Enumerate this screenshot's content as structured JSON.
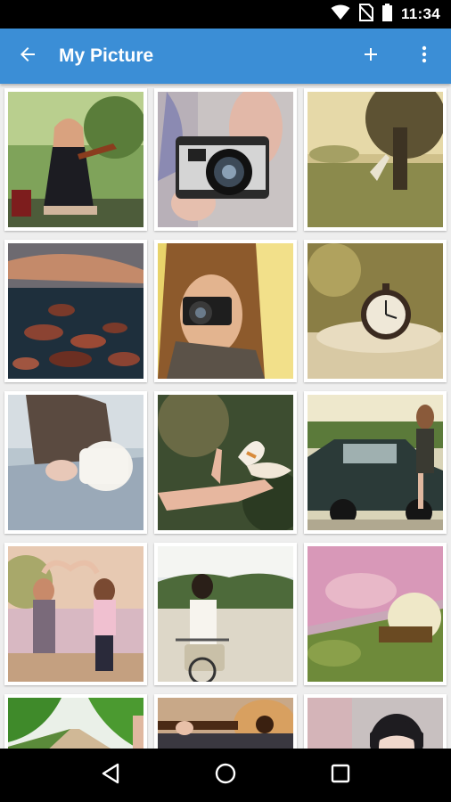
{
  "status_bar": {
    "time": "11:34",
    "icons": [
      "wifi-icon",
      "no-sim-icon",
      "battery-icon"
    ]
  },
  "app_bar": {
    "title": "My Picture",
    "back_icon": "arrow-left-icon",
    "add_icon": "plus-icon",
    "menu_icon": "more-vert-icon",
    "color": "#3b8ed6"
  },
  "gallery": {
    "photos": [
      "photo-violin-girl",
      "photo-vintage-camera",
      "photo-tree-field",
      "photo-rocky-sea",
      "photo-girl-with-camera",
      "photo-pocket-watch",
      "photo-girl-with-cup",
      "photo-butterfly-hand",
      "photo-girl-on-car",
      "photo-two-girls-heart",
      "photo-girl-on-bicycle",
      "photo-girl-with-guitar-grass",
      "photo-country-road",
      "photo-acoustic-guitar",
      "photo-girl-portrait"
    ]
  },
  "nav_bar": {
    "icons": [
      "back-triangle-icon",
      "home-circle-icon",
      "recents-square-icon"
    ]
  }
}
